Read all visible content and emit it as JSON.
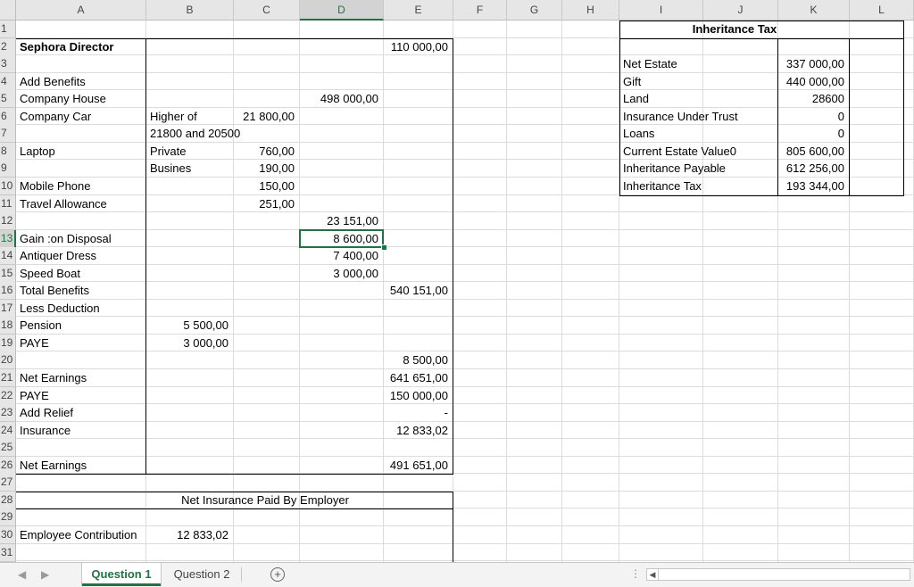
{
  "columns": [
    "A",
    "B",
    "C",
    "D",
    "E",
    "F",
    "G",
    "H",
    "I",
    "J",
    "K",
    "L"
  ],
  "selected_column": "D",
  "selected_row": 13,
  "rows": [
    "1",
    "2",
    "3",
    "4",
    "5",
    "6",
    "7",
    "8",
    "9",
    "10",
    "11",
    "12",
    "13",
    "14",
    "15",
    "16",
    "17",
    "18",
    "19",
    "20",
    "21",
    "22",
    "23",
    "24",
    "25",
    "26",
    "27",
    "28",
    "29",
    "30",
    "31"
  ],
  "cells": [
    {
      "row": 2,
      "col": "A",
      "text": "Sephora Director",
      "bold": true
    },
    {
      "row": 2,
      "col": "E",
      "text": "110 000,00",
      "align": "right"
    },
    {
      "row": 4,
      "col": "A",
      "text": "Add Benefits"
    },
    {
      "row": 5,
      "col": "A",
      "text": "Company House"
    },
    {
      "row": 5,
      "col": "D",
      "text": "498 000,00",
      "align": "right"
    },
    {
      "row": 6,
      "col": "A",
      "text": "Company Car"
    },
    {
      "row": 6,
      "col": "B",
      "text": "Higher of"
    },
    {
      "row": 6,
      "col": "C",
      "text": "21 800,00",
      "align": "right"
    },
    {
      "row": 7,
      "col": "B",
      "text": "21800 and 20500"
    },
    {
      "row": 8,
      "col": "A",
      "text": "Laptop"
    },
    {
      "row": 8,
      "col": "B",
      "text": "Private"
    },
    {
      "row": 8,
      "col": "C",
      "text": "760,00",
      "align": "right"
    },
    {
      "row": 9,
      "col": "B",
      "text": "Busines"
    },
    {
      "row": 9,
      "col": "C",
      "text": "190,00",
      "align": "right"
    },
    {
      "row": 10,
      "col": "A",
      "text": "Mobile Phone"
    },
    {
      "row": 10,
      "col": "C",
      "text": "150,00",
      "align": "right"
    },
    {
      "row": 11,
      "col": "A",
      "text": "Travel Allowance"
    },
    {
      "row": 11,
      "col": "C",
      "text": "251,00",
      "align": "right"
    },
    {
      "row": 12,
      "col": "D",
      "text": "23 151,00",
      "align": "right"
    },
    {
      "row": 13,
      "col": "A",
      "text": "Gain :on Disposal"
    },
    {
      "row": 13,
      "col": "D",
      "text": "8 600,00",
      "align": "right"
    },
    {
      "row": 14,
      "col": "A",
      "text": "Antiquer Dress"
    },
    {
      "row": 14,
      "col": "D",
      "text": "7 400,00",
      "align": "right"
    },
    {
      "row": 15,
      "col": "A",
      "text": "Speed Boat"
    },
    {
      "row": 15,
      "col": "D",
      "text": "3 000,00",
      "align": "right"
    },
    {
      "row": 16,
      "col": "A",
      "text": "Total Benefits"
    },
    {
      "row": 16,
      "col": "E",
      "text": "540 151,00",
      "align": "right"
    },
    {
      "row": 17,
      "col": "A",
      "text": " Less Deduction"
    },
    {
      "row": 18,
      "col": "A",
      "text": "Pension"
    },
    {
      "row": 18,
      "col": "B",
      "text": "5 500,00",
      "align": "right"
    },
    {
      "row": 19,
      "col": "A",
      "text": "PAYE"
    },
    {
      "row": 19,
      "col": "B",
      "text": "3 000,00",
      "align": "right"
    },
    {
      "row": 20,
      "col": "E",
      "text": "8 500,00",
      "align": "right"
    },
    {
      "row": 21,
      "col": "A",
      "text": "Net Earnings"
    },
    {
      "row": 21,
      "col": "E",
      "text": "641 651,00",
      "align": "right"
    },
    {
      "row": 22,
      "col": "A",
      "text": "PAYE"
    },
    {
      "row": 22,
      "col": "E",
      "text": "150 000,00",
      "align": "right"
    },
    {
      "row": 23,
      "col": "A",
      "text": "Add Relief"
    },
    {
      "row": 23,
      "col": "E",
      "text": "-",
      "align": "right"
    },
    {
      "row": 24,
      "col": "A",
      "text": "Insurance"
    },
    {
      "row": 24,
      "col": "E",
      "text": "12 833,02",
      "align": "right"
    },
    {
      "row": 26,
      "col": "A",
      "text": "Net Earnings"
    },
    {
      "row": 26,
      "col": "E",
      "text": "491 651,00",
      "align": "right"
    },
    {
      "row": 28,
      "col": "B",
      "text": "Net Insurance Paid By Employer",
      "span": "B-D",
      "align": "center"
    },
    {
      "row": 30,
      "col": "A",
      "text": "Employee Contribution"
    },
    {
      "row": 30,
      "col": "B",
      "text": "12 833,02",
      "align": "right"
    },
    {
      "row": 1,
      "col": "I",
      "text": "Inheritance Tax",
      "bold": true,
      "span": "I-K",
      "align": "center"
    },
    {
      "row": 3,
      "col": "I",
      "text": "Net Estate"
    },
    {
      "row": 3,
      "col": "K",
      "text": "337 000,00",
      "align": "right"
    },
    {
      "row": 4,
      "col": "I",
      "text": "Gift"
    },
    {
      "row": 4,
      "col": "K",
      "text": "440 000,00",
      "align": "right"
    },
    {
      "row": 5,
      "col": "I",
      "text": "Land"
    },
    {
      "row": 5,
      "col": "K",
      "text": "28600",
      "align": "right"
    },
    {
      "row": 6,
      "col": "I",
      "text": "Insurance Under Trust"
    },
    {
      "row": 6,
      "col": "K",
      "text": "0",
      "align": "right"
    },
    {
      "row": 7,
      "col": "I",
      "text": "Loans"
    },
    {
      "row": 7,
      "col": "K",
      "text": "0",
      "align": "right"
    },
    {
      "row": 8,
      "col": "I",
      "text": "Current Estate Value0"
    },
    {
      "row": 8,
      "col": "K",
      "text": "805 600,00",
      "align": "right"
    },
    {
      "row": 9,
      "col": "I",
      "text": "Inheritance Payable"
    },
    {
      "row": 9,
      "col": "K",
      "text": "612 256,00",
      "align": "right"
    },
    {
      "row": 10,
      "col": "I",
      "text": "Inheritance Tax"
    },
    {
      "row": 10,
      "col": "K",
      "text": "193 344,00",
      "align": "right"
    }
  ],
  "sheet_tabs": [
    {
      "label": "Question 1",
      "active": true
    },
    {
      "label": "Question 2",
      "active": false
    }
  ],
  "tabbar": {
    "nav_prev": "◀",
    "nav_next": "▶",
    "add_sheet": "+",
    "options": "⋮",
    "scroll_left": "◀"
  }
}
